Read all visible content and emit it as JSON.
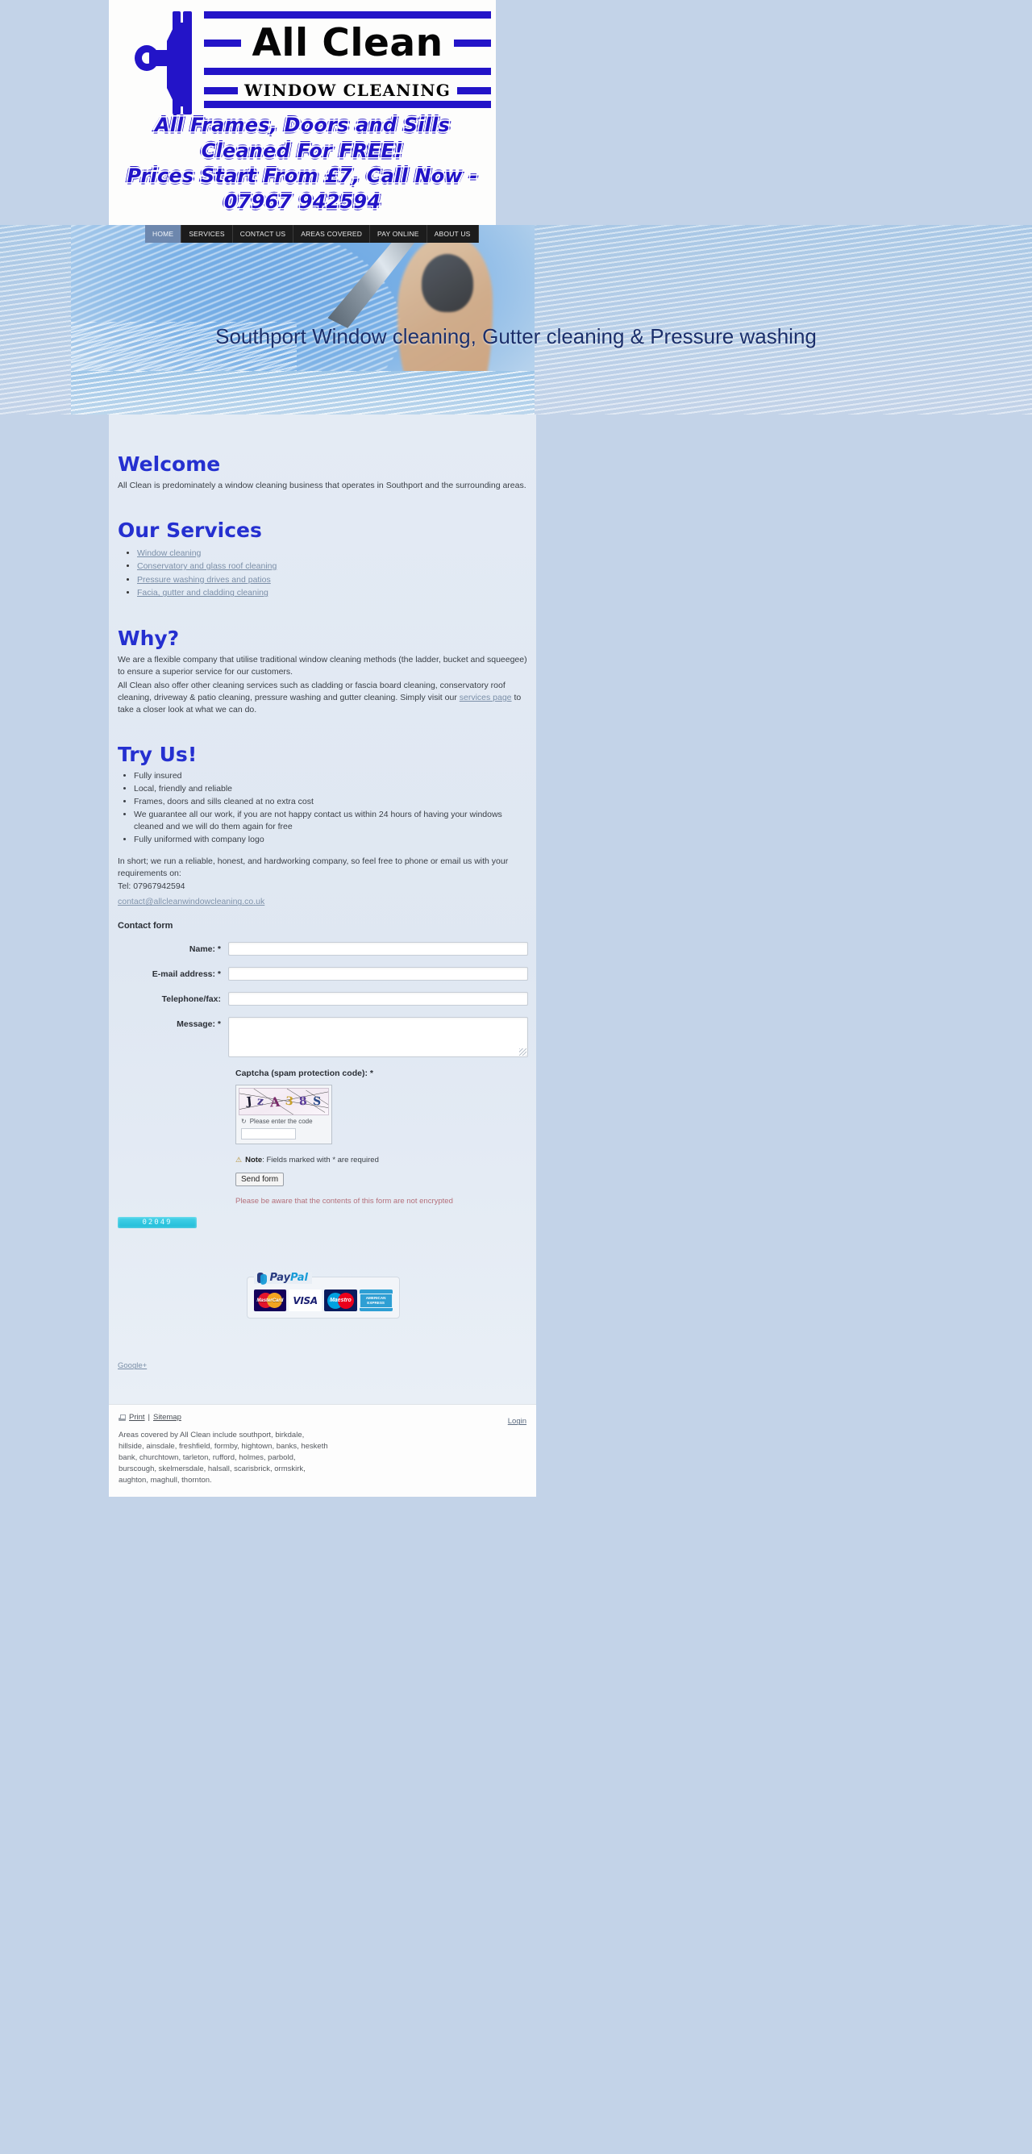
{
  "logo": {
    "brand_primary": "All Clean",
    "brand_secondary": "WINDOW CLEANING",
    "icon": "squeegee-icon",
    "accent_color": "#2314c8"
  },
  "tagline": {
    "line1": "All Frames, Doors and Sills Cleaned For FREE!",
    "line2": "Prices Start From £7, Call Now - 07967 942594"
  },
  "nav": {
    "items": [
      {
        "label": "HOME",
        "active": true
      },
      {
        "label": "SERVICES",
        "active": false
      },
      {
        "label": "CONTACT US",
        "active": false
      },
      {
        "label": "AREAS COVERED",
        "active": false
      },
      {
        "label": "PAY ONLINE",
        "active": false
      },
      {
        "label": "ABOUT US",
        "active": false
      }
    ]
  },
  "hero": {
    "title": "Southport Window cleaning, Gutter cleaning & Pressure washing"
  },
  "welcome": {
    "heading": "Welcome",
    "body": "All Clean is predominately a window cleaning business that operates in Southport and the surrounding areas."
  },
  "services": {
    "heading": "Our Services",
    "items": [
      "Window cleaning",
      "Conservatory and glass roof cleaning",
      "Pressure washing drives and patios",
      "Facia, gutter and cladding cleaning"
    ]
  },
  "why": {
    "heading": "Why?",
    "para1": "We are a flexible company that utilise traditional window cleaning methods (the ladder, bucket and squeegee) to ensure a superior service for our customers.",
    "para2_before": "All Clean also offer other cleaning services such as cladding or fascia board cleaning, conservatory roof cleaning, driveway & patio cleaning, pressure washing and gutter cleaning. Simply visit our ",
    "para2_link": "services page",
    "para2_after": " to take a closer look at what we can do."
  },
  "try": {
    "heading": "Try Us!",
    "items": [
      "Fully insured",
      "Local, friendly and reliable",
      "Frames, doors and sills cleaned at no extra cost",
      "We guarantee all our work, if you are not happy contact us within 24 hours of having your windows cleaned and we will do them again for free",
      "Fully uniformed with company logo"
    ]
  },
  "contact": {
    "intro": "In short; we run a reliable, honest, and hardworking company, so feel free to phone or email us with your requirements on:",
    "tel": "Tel: 07967942594",
    "email": "contact@allcleanwindowcleaning.co.uk",
    "form_heading": "Contact form"
  },
  "form": {
    "fields": [
      {
        "label": "Name: *",
        "value": "",
        "type": "text"
      },
      {
        "label": "E-mail address: *",
        "value": "",
        "type": "text"
      },
      {
        "label": "Telephone/fax:",
        "value": "",
        "type": "text"
      },
      {
        "label": "Message: *",
        "value": "",
        "type": "textarea"
      }
    ],
    "captcha_label": "Captcha (spam protection code): *",
    "captcha_code": "JzA38S",
    "captcha_chars": [
      "J",
      "z",
      "A",
      "3",
      "8",
      "S"
    ],
    "captcha_reload_label": "Please enter the code",
    "captcha_input_value": "",
    "note_label": "Note",
    "note_text": ": Fields marked with * are required",
    "submit_label": "Send form",
    "encryption_warning": "Please be aware that the contents of this form are not encrypted"
  },
  "counter": {
    "value": "02049"
  },
  "paypal": {
    "brand": "PayPal",
    "brand_part1": "Pay",
    "brand_part2": "Pal",
    "cards": [
      "MasterCard",
      "VISA",
      "Maestro",
      "AMERICAN EXPRESS"
    ]
  },
  "social": {
    "google_plus": "Google+"
  },
  "footer": {
    "print": "Print",
    "separator": "|",
    "sitemap": "Sitemap",
    "login": "Login",
    "areas_lines": [
      "Areas covered by All Clean include southport, birkdale,",
      "hillside, ainsdale, freshfield, formby, hightown, banks, hesketh",
      "bank, churchtown, tarleton, rufford, holmes, parbold,",
      "burscough, skelmersdale, halsall, scarisbrick, ormskirk,",
      "aughton, maghull, thornton."
    ]
  }
}
